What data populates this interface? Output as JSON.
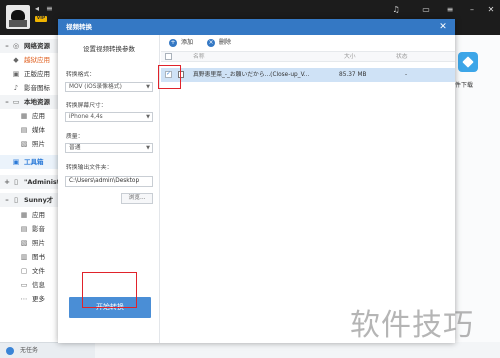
{
  "app": {
    "vip_badge": "VIP",
    "status_text": "无任务"
  },
  "sidebar": {
    "items": [
      {
        "label": "网络资源"
      },
      {
        "label": "越狱应用"
      },
      {
        "label": "正版应用"
      },
      {
        "label": "影音图标"
      },
      {
        "label": "本地资源"
      },
      {
        "label": "应用"
      },
      {
        "label": "媒体"
      },
      {
        "label": "照片"
      },
      {
        "label": "工具箱"
      },
      {
        "label": "\"Administ"
      },
      {
        "label": "Sunny才"
      },
      {
        "label": "应用"
      },
      {
        "label": "影音"
      },
      {
        "label": "照片"
      },
      {
        "label": "图书"
      },
      {
        "label": "文件"
      },
      {
        "label": "信息"
      },
      {
        "label": "更多"
      }
    ]
  },
  "right_panel": {
    "label": "件下载"
  },
  "dialog": {
    "title": "视频转换",
    "settings": {
      "title": "设置视频转换参数",
      "format_label": "转换格式：",
      "format_value": "MOV (iOS录像格式)",
      "size_label": "转换屏幕尺寸：",
      "size_value": "iPhone 4,4s",
      "quality_label": "质量：",
      "quality_value": "普通",
      "output_label": "转换输出文件夹：",
      "output_value": "C:\\Users\\admin\\Desktop",
      "browse_label": "浏览...",
      "start_label": "开始转换"
    },
    "toolbar": {
      "add_label": "添加",
      "delete_label": "删除"
    },
    "list": {
      "columns": [
        "名称",
        "大小",
        "状态"
      ],
      "rows": [
        {
          "name": "真野恵里菜_-_お願いだから...(Close-up_V...",
          "size": "85.37 MB",
          "status": "-"
        }
      ]
    }
  },
  "watermark": "软件技巧",
  "colors": {
    "title_bar": "#3478c4",
    "start_button": "#4a8ed6",
    "highlight_box": "#e0232b",
    "selected_row": "#cfe2f6"
  }
}
